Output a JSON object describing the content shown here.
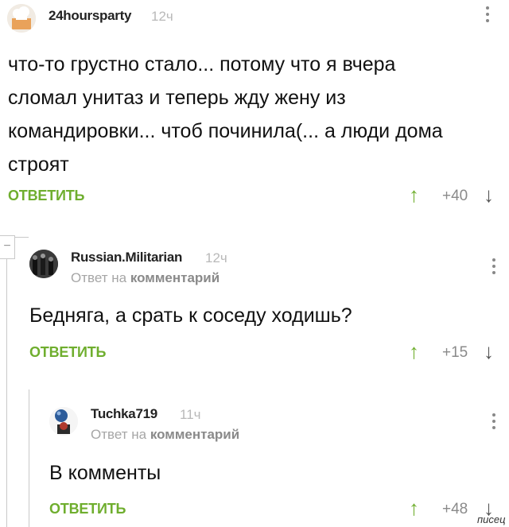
{
  "comments": [
    {
      "author": "24hoursparty",
      "time": "12ч",
      "text_lines": [
        "что-то грустно стало... потому что я вчера",
        "сломал унитаз и теперь жду жену из",
        "командировки... чтоб починила(... а люди дома",
        "строят"
      ],
      "reply_label": "ОТВЕТИТЬ",
      "score": "+40",
      "up_icon": "arrow-up-icon",
      "down_icon": "arrow-down-icon"
    },
    {
      "author": "Russian.Militarian",
      "time": "12ч",
      "reply_prefix": "Ответ на",
      "reply_target": "комментарий",
      "text": "Бедняга, а срать к соседу ходишь?",
      "reply_label": "ОТВЕТИТЬ",
      "score": "+15"
    },
    {
      "author": "Tuchka719",
      "time": "11ч",
      "reply_prefix": "Ответ на",
      "reply_target": "комментарий",
      "text": "В комменты",
      "reply_label": "ОТВЕТИТЬ",
      "score": "+48"
    }
  ],
  "collapse_symbol": "−",
  "watermark": "писец",
  "colors": {
    "accent": "#6fae2e",
    "muted": "#b9b9b9",
    "thread_line": "#c9c9c9"
  }
}
